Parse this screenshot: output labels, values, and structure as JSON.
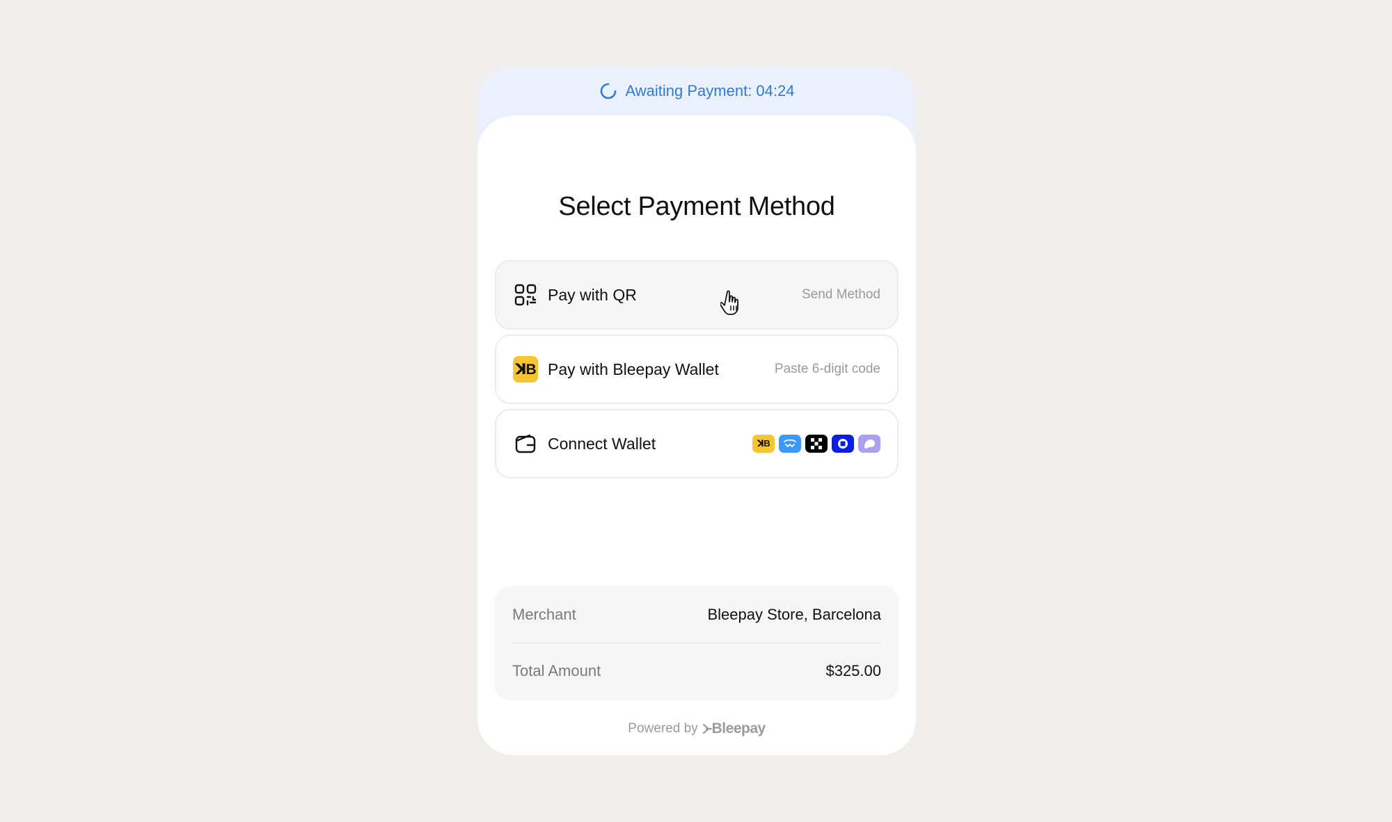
{
  "status": {
    "label": "Awaiting Payment: 04:24",
    "color": "#2f7ad8",
    "icon": "spinner-icon"
  },
  "title": "Select Payment Method",
  "methods": [
    {
      "icon": "qr-code-icon",
      "label": "Pay with QR",
      "hint": "Send Method"
    },
    {
      "icon": "bleepay-logo-icon",
      "badge": "ꓘB",
      "label": "Pay with Bleepay Wallet",
      "hint": "Paste 6-digit code"
    },
    {
      "icon": "wallet-icon",
      "label": "Connect Wallet",
      "wallets": [
        "bleepay-wallet-icon",
        "blue-wave-wallet-icon",
        "checker-wallet-icon",
        "blue-circle-wallet-icon",
        "purple-ghost-wallet-icon"
      ]
    }
  ],
  "summary": {
    "merchant_label": "Merchant",
    "merchant_value": "Bleepay Store, Barcelona",
    "total_label": "Total Amount",
    "total_value": "$325.00"
  },
  "footer": {
    "powered_by": "Powered by",
    "brand": "Bleepay"
  },
  "colors": {
    "background": "#f1efed",
    "accent_yellow": "#f7c531",
    "status_blue": "#2f7ad8"
  }
}
